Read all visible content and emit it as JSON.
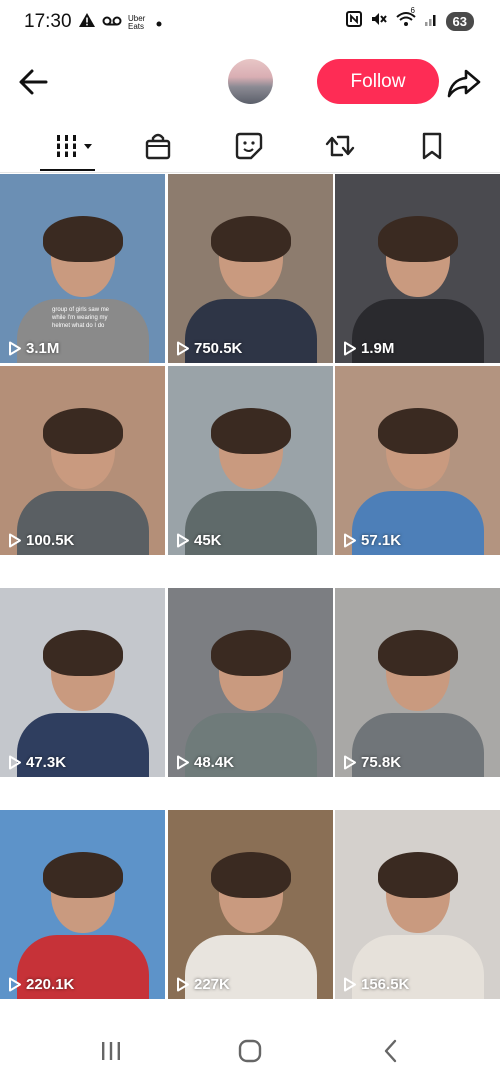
{
  "status_bar": {
    "time": "17:30",
    "notification_app": "Uber Eats",
    "battery": "63",
    "wifi_badge": "6",
    "icons": [
      "warning-icon",
      "voicemail-icon",
      "uber-eats-icon",
      "dot-icon",
      "nfc-icon",
      "mute-icon",
      "wifi-icon",
      "signal-icon",
      "battery-icon"
    ]
  },
  "header": {
    "follow_label": "Follow",
    "icons": [
      "back-arrow-icon",
      "share-icon"
    ]
  },
  "tabs": [
    {
      "name": "videos",
      "icon": "grid-view-icon"
    },
    {
      "name": "shop",
      "icon": "shopping-bag-icon"
    },
    {
      "name": "stickers",
      "icon": "sticker-icon"
    },
    {
      "name": "reposts",
      "icon": "repost-icon"
    },
    {
      "name": "saved",
      "icon": "bookmark-icon"
    }
  ],
  "videos": [
    {
      "views": "3.1M",
      "caption": "group of girls saw me while I'm wearing my helmet what do I do",
      "bg": "#6b8fb4",
      "shirt": "#8a8a8a"
    },
    {
      "views": "750.5K",
      "caption": "",
      "bg": "#8d7c6e",
      "shirt": "#2e3546"
    },
    {
      "views": "1.9M",
      "caption": "",
      "bg": "#4a4a4f",
      "shirt": "#2a2a2e"
    },
    {
      "views": "100.5K",
      "caption": "",
      "bg": "#b48f78",
      "shirt": "#5a5f63"
    },
    {
      "views": "45K",
      "caption": "",
      "bg": "#9aa3a8",
      "shirt": "#5f6a6a"
    },
    {
      "views": "57.1K",
      "caption": "",
      "bg": "#b39480",
      "shirt": "#4d7fb8"
    },
    {
      "views": "47.3K",
      "caption": "",
      "bg": "#c4c7cc",
      "shirt": "#2f3e5f"
    },
    {
      "views": "48.4K",
      "caption": "",
      "bg": "#7c7e82",
      "shirt": "#6f7b7a"
    },
    {
      "views": "75.8K",
      "caption": "",
      "bg": "#a9a8a6",
      "shirt": "#707579"
    },
    {
      "views": "220.1K",
      "caption": "",
      "bg": "#5d93c9",
      "shirt": "#c63238"
    },
    {
      "views": "227K",
      "caption": "",
      "bg": "#8a6f55",
      "shirt": "#e8e4de"
    },
    {
      "views": "156.5K",
      "caption": "",
      "bg": "#d4d0cc",
      "shirt": "#e6e1da"
    }
  ],
  "nav_bar": {
    "icons": [
      "recent-apps-icon",
      "home-icon",
      "back-icon"
    ]
  }
}
